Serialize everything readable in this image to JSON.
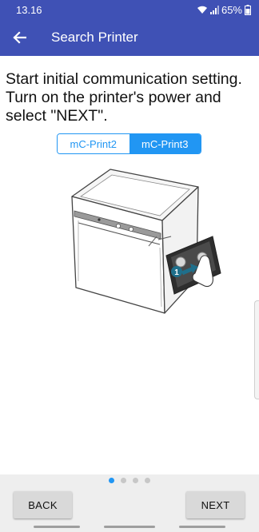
{
  "status_bar": {
    "time": "13.16",
    "battery": "65%"
  },
  "app_bar": {
    "title": "Search Printer"
  },
  "instruction": "Start initial communication setting. Turn on the printer's power and select \"NEXT\".",
  "models": {
    "option_1": "mC-Print2",
    "option_2": "mC-Print3",
    "selected": "mC-Print3"
  },
  "illustration": {
    "step_marker": "1"
  },
  "pager": {
    "total": 4,
    "current": 1
  },
  "buttons": {
    "back": "BACK",
    "next": "NEXT"
  },
  "colors": {
    "primary": "#3f51b5",
    "accent": "#2196f3",
    "marker": "#1f6f8b"
  }
}
